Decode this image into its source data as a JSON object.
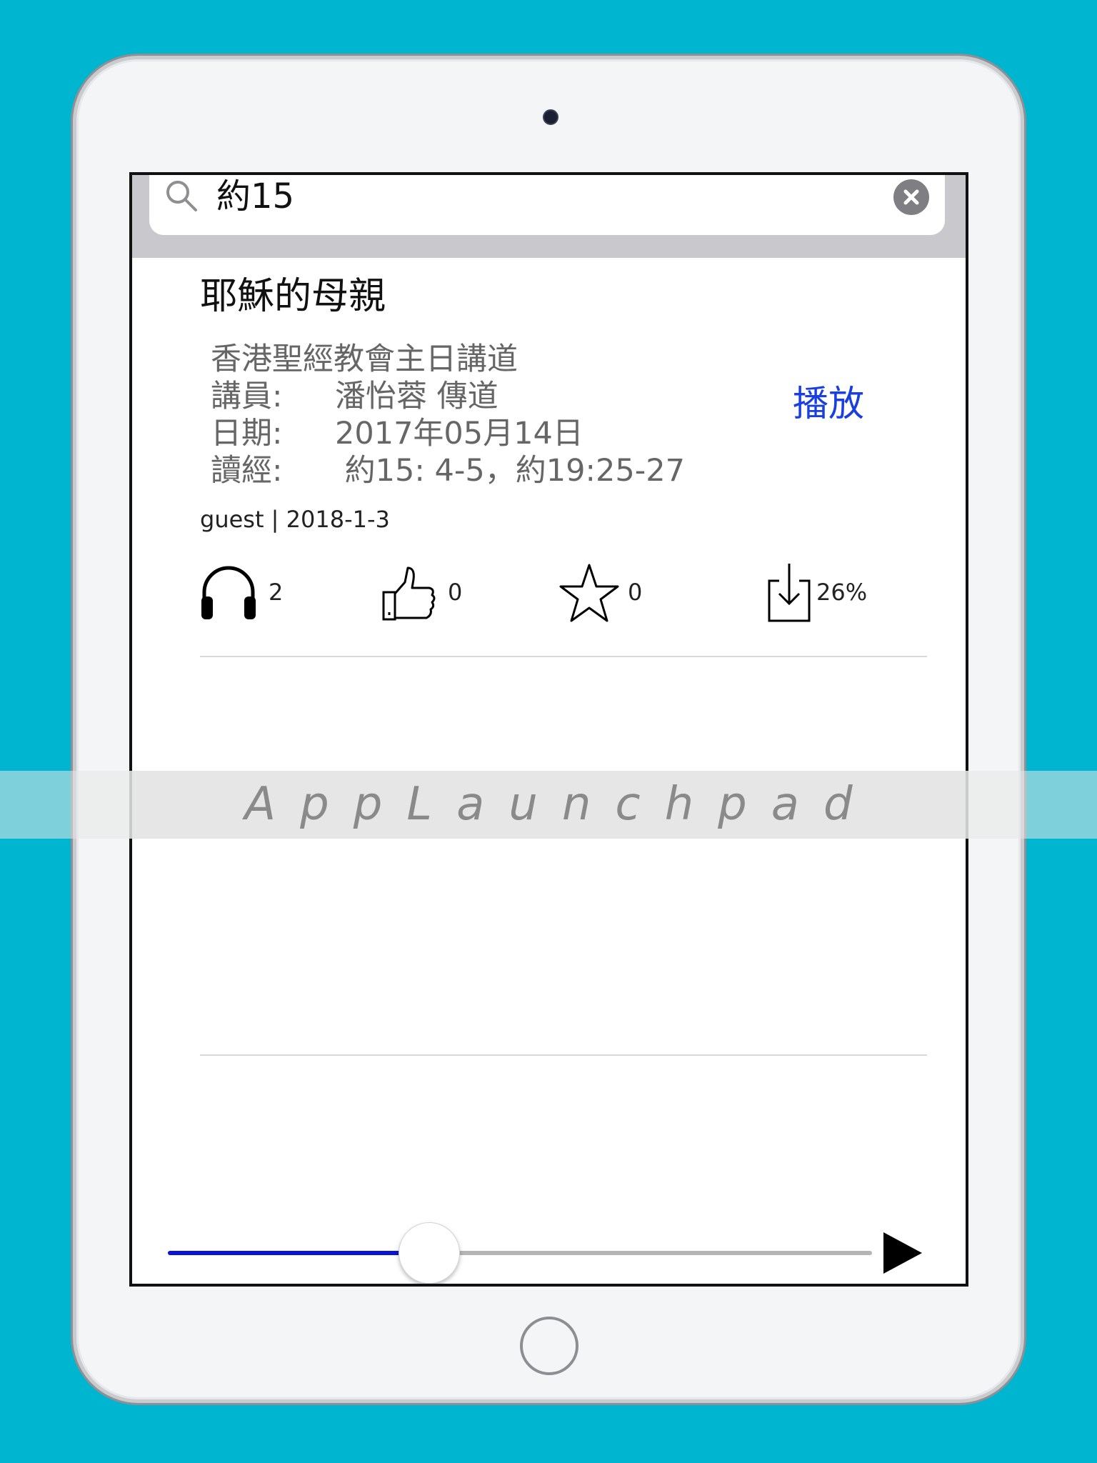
{
  "search": {
    "query": "約15"
  },
  "sermon": {
    "title": "耶穌的母親",
    "description": [
      {
        "key": "",
        "value": "香港聖經教會主日講道"
      },
      {
        "key": "講員:",
        "value": "潘怡蓉 傳道"
      },
      {
        "key": "日期:",
        "value": "2017年05月14日"
      },
      {
        "key": "讀經:",
        "value": " 約15: 4-5，約19:25-27"
      }
    ],
    "play_label": "播放",
    "meta": "guest | 2018-1-3"
  },
  "stats": {
    "listens": "2",
    "likes": "0",
    "favorites": "0",
    "download": "26%"
  },
  "icons": {
    "search": "search-icon",
    "clear": "clear-icon",
    "listens": "headphones-icon",
    "likes": "thumbs-up-icon",
    "favorites": "star-icon",
    "download": "download-icon",
    "play": "play-icon"
  },
  "player": {
    "progress": 0.37
  },
  "watermark": "AppLaunchpad",
  "colors": {
    "background": "#00b5cf",
    "link": "#1a3fe0",
    "progress": "#0a14d8"
  }
}
